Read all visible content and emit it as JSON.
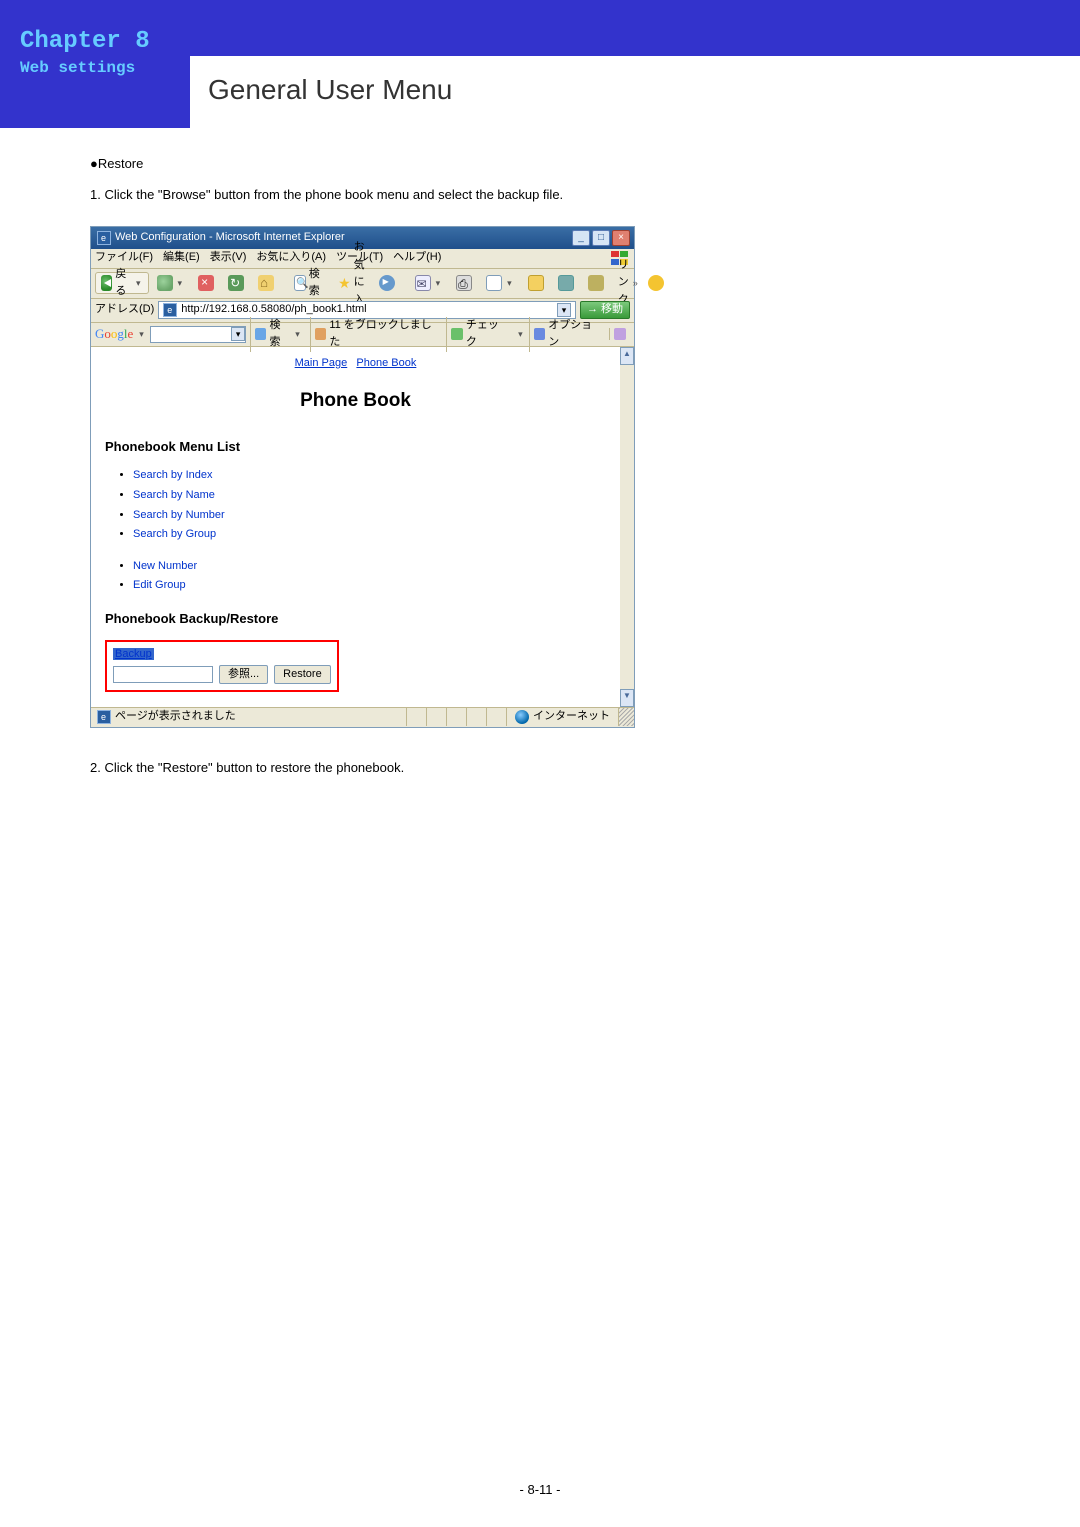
{
  "header": {
    "chapter": "Chapter 8",
    "subtitle": "Web settings",
    "title": "General User Menu"
  },
  "body": {
    "section_heading": "●Restore",
    "step1": "1. Click the \"Browse\" button from the phone book menu and select the backup file.",
    "step2": "2. Click the \"Restore\" button to restore the phonebook."
  },
  "page_number": "- 8-11 -",
  "screenshot": {
    "titlebar": "Web Configuration - Microsoft Internet Explorer",
    "menu": {
      "file": "ファイル(F)",
      "edit": "編集(E)",
      "view": "表示(V)",
      "fav": "お気に入り(A)",
      "tool": "ツール(T)",
      "help": "ヘルプ(H)"
    },
    "toolbar": {
      "back": "戻る",
      "search": "検索",
      "favorites": "お気に入り",
      "links": "リンク"
    },
    "address": {
      "label": "アドレス(D)",
      "url": "http://192.168.0.58080/ph_book1.html",
      "go": "移動"
    },
    "google": {
      "search_btn": "検索",
      "blocked": "11 をブロックしました",
      "check": "チェック",
      "options": "オプション"
    },
    "content": {
      "crumb_main": "Main Page",
      "crumb_pb": "Phone Book",
      "title": "Phone Book",
      "menu_list_head": "Phonebook Menu List",
      "links1": [
        "Search by Index",
        "Search by Name",
        "Search by Number",
        "Search by Group"
      ],
      "links2": [
        "New Number",
        "Edit Group"
      ],
      "backup_head": "Phonebook Backup/Restore",
      "backup_link": "Backup",
      "browse_btn": "参照...",
      "restore_btn": "Restore"
    },
    "status": {
      "text": "ページが表示されました",
      "zone": "インターネット"
    }
  }
}
